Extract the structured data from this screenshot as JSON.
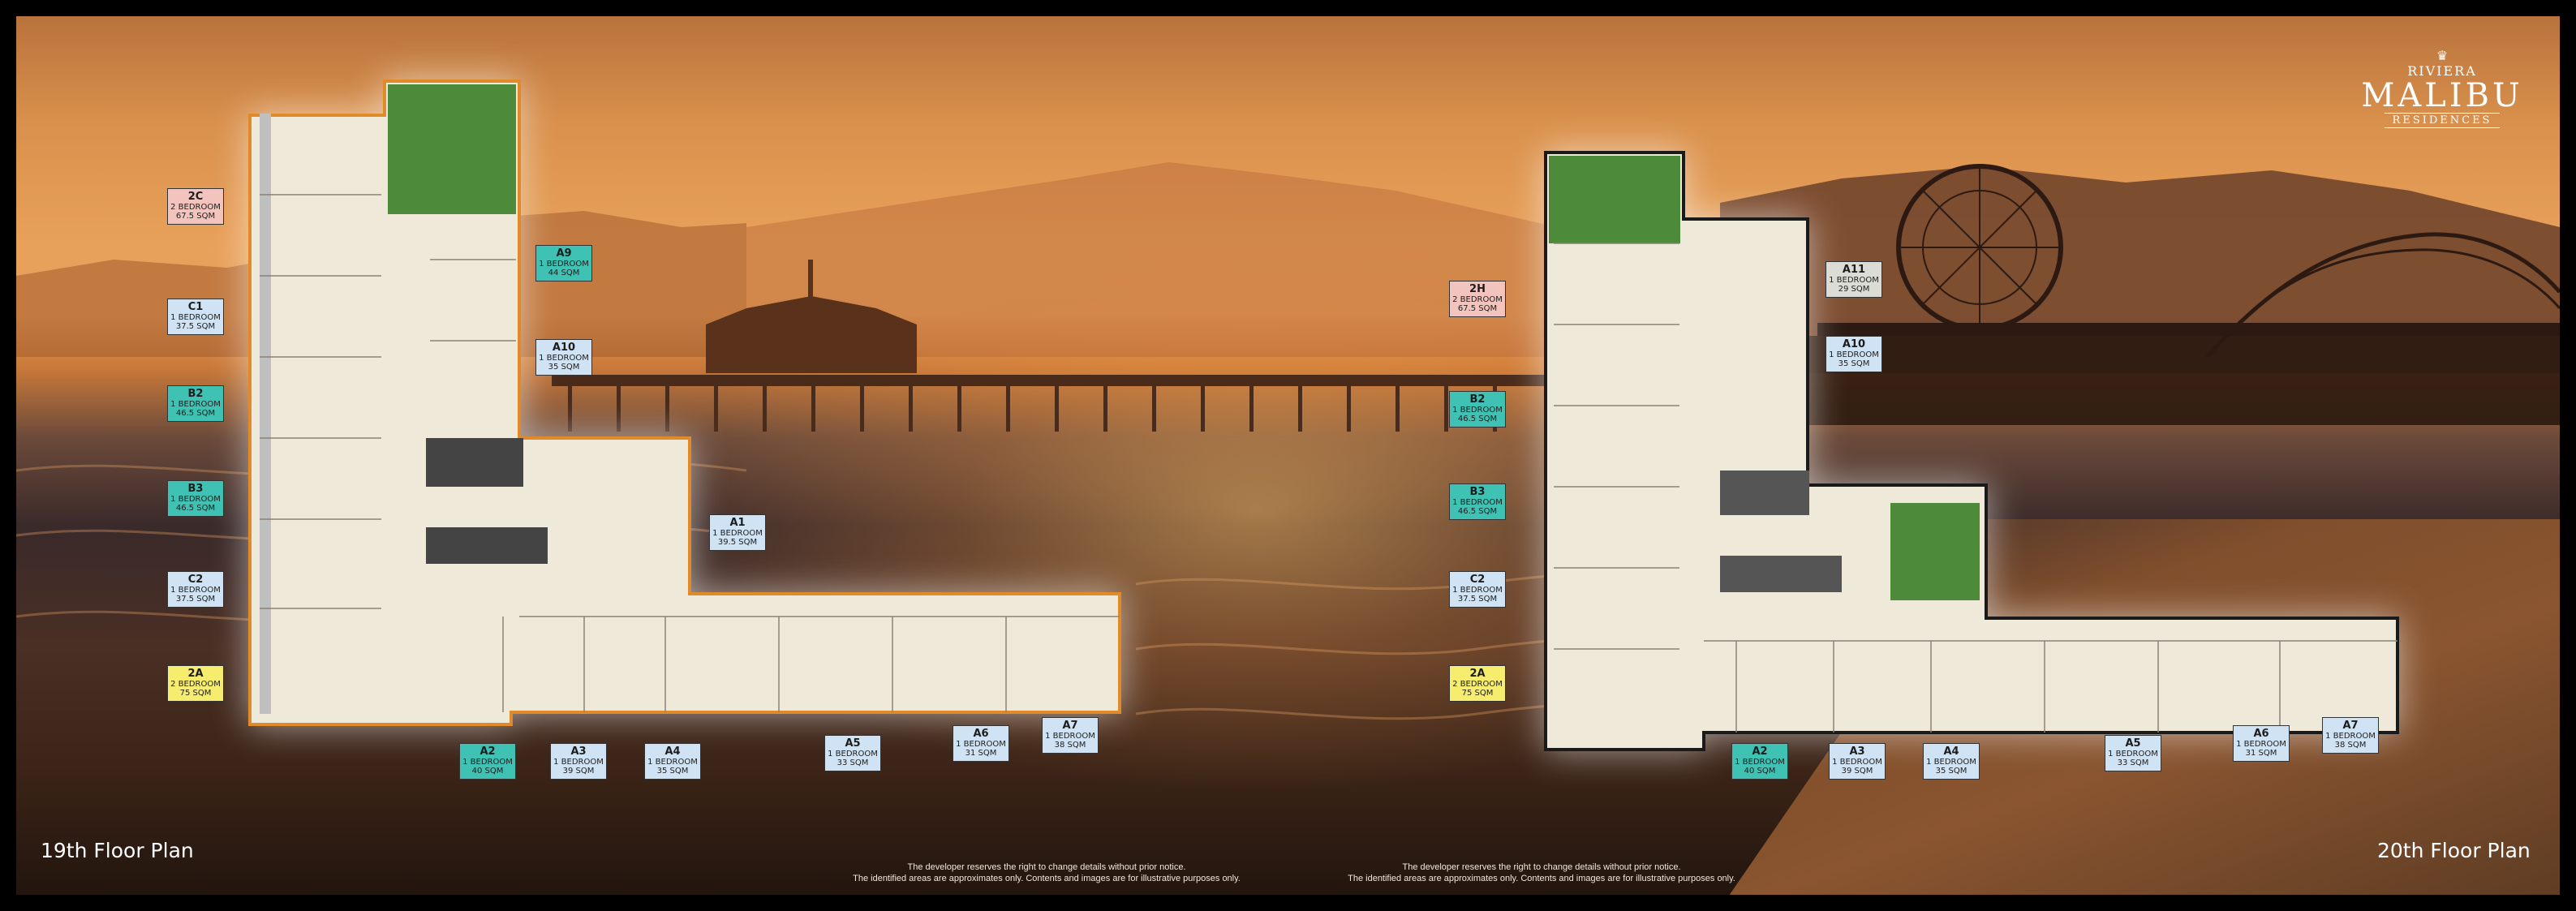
{
  "logo": {
    "brand": "RIVIERA",
    "name": "MALIBU",
    "sub": "RESIDENCES"
  },
  "floors": [
    {
      "title": "19th Floor Plan"
    },
    {
      "title": "20th Floor Plan"
    }
  ],
  "disclaimer": {
    "line1": "The developer reserves the right to change details without prior notice.",
    "line2": "The identified areas are approximates only.  Contents and images are for illustrative purposes only."
  },
  "units19": [
    {
      "code": "2C",
      "type": "2 BEDROOM",
      "area": "67.5 SQM",
      "color": "pink"
    },
    {
      "code": "C1",
      "type": "1 BEDROOM",
      "area": "37.5 SQM",
      "color": "blue"
    },
    {
      "code": "B2",
      "type": "1 BEDROOM",
      "area": "46.5 SQM",
      "color": "teal"
    },
    {
      "code": "B3",
      "type": "1 BEDROOM",
      "area": "46.5 SQM",
      "color": "teal"
    },
    {
      "code": "C2",
      "type": "1 BEDROOM",
      "area": "37.5 SQM",
      "color": "blue"
    },
    {
      "code": "2A",
      "type": "2 BEDROOM",
      "area": "75 SQM",
      "color": "yellow"
    },
    {
      "code": "A9",
      "type": "1 BEDROOM",
      "area": "44 SQM",
      "color": "teal"
    },
    {
      "code": "A10",
      "type": "1 BEDROOM",
      "area": "35 SQM",
      "color": "blue"
    },
    {
      "code": "A1",
      "type": "1 BEDROOM",
      "area": "39.5 SQM",
      "color": "blue"
    },
    {
      "code": "A2",
      "type": "1 BEDROOM",
      "area": "40 SQM",
      "color": "teal"
    },
    {
      "code": "A3",
      "type": "1 BEDROOM",
      "area": "39 SQM",
      "color": "blue"
    },
    {
      "code": "A4",
      "type": "1 BEDROOM",
      "area": "35 SQM",
      "color": "blue"
    },
    {
      "code": "A5",
      "type": "1 BEDROOM",
      "area": "33 SQM",
      "color": "blue"
    },
    {
      "code": "A6",
      "type": "1 BEDROOM",
      "area": "31 SQM",
      "color": "blue"
    },
    {
      "code": "A7",
      "type": "1 BEDROOM",
      "area": "38 SQM",
      "color": "blue"
    }
  ],
  "units20": [
    {
      "code": "2H",
      "type": "2 BEDROOM",
      "area": "67.5 SQM",
      "color": "pink"
    },
    {
      "code": "B2",
      "type": "1 BEDROOM",
      "area": "46.5 SQM",
      "color": "teal"
    },
    {
      "code": "B3",
      "type": "1 BEDROOM",
      "area": "46.5 SQM",
      "color": "teal"
    },
    {
      "code": "C2",
      "type": "1 BEDROOM",
      "area": "37.5 SQM",
      "color": "blue"
    },
    {
      "code": "2A",
      "type": "2 BEDROOM",
      "area": "75 SQM",
      "color": "yellow"
    },
    {
      "code": "A11",
      "type": "1 BEDROOM",
      "area": "29 SQM",
      "color": "grey"
    },
    {
      "code": "A10",
      "type": "1 BEDROOM",
      "area": "35 SQM",
      "color": "blue"
    },
    {
      "code": "A2",
      "type": "1 BEDROOM",
      "area": "40 SQM",
      "color": "teal"
    },
    {
      "code": "A3",
      "type": "1 BEDROOM",
      "area": "39 SQM",
      "color": "blue"
    },
    {
      "code": "A4",
      "type": "1 BEDROOM",
      "area": "35 SQM",
      "color": "blue"
    },
    {
      "code": "A5",
      "type": "1 BEDROOM",
      "area": "33 SQM",
      "color": "blue"
    },
    {
      "code": "A6",
      "type": "1 BEDROOM",
      "area": "31 SQM",
      "color": "blue"
    },
    {
      "code": "A7",
      "type": "1 BEDROOM",
      "area": "38 SQM",
      "color": "blue"
    }
  ],
  "colors": {
    "pink": "#f3c3bd",
    "blue": "#cfe3f4",
    "teal": "#3fc2b3",
    "yellow": "#f6ec6e",
    "grey": "#dcdcd6",
    "plan_outline_19": "#e08a2a"
  }
}
